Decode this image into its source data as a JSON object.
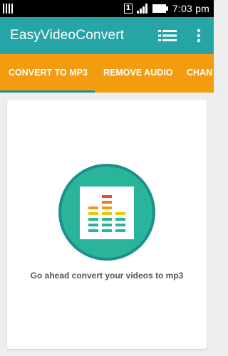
{
  "status_bar": {
    "sim_slot": "1",
    "time": "7:03 pm"
  },
  "app_bar": {
    "title": "EasyVideoConvert",
    "icons": [
      "list-icon",
      "more-vert-icon"
    ]
  },
  "tabs": [
    {
      "label": "CONVERT TO MP3",
      "selected": true
    },
    {
      "label": "REMOVE AUDIO",
      "selected": false
    },
    {
      "label": "CHAN",
      "selected": false
    }
  ],
  "main": {
    "caption": "Go ahead convert your videos to mp3"
  },
  "colors": {
    "app_bar": "#26a4a6",
    "tab_bar": "#f39c10",
    "tab_indicator": "#1e8f91",
    "icon_circle": "#2ab59a",
    "icon_ring": "#1e8f91",
    "background": "#eeeeee"
  }
}
